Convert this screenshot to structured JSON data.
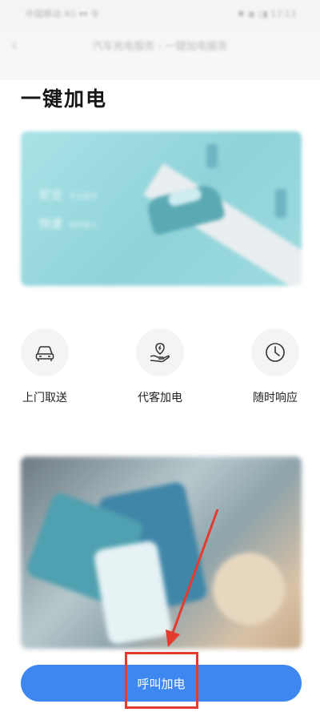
{
  "status_bar": {
    "left": "中国移动 4G ▾▾ 令",
    "right": "✱ ◉ ▯▮ 17:13"
  },
  "nav": {
    "title": "汽车充电服务 - 一键加电服务"
  },
  "page": {
    "title": "一键加电"
  },
  "banner": {
    "line1": "安全",
    "line1_sub": "专业服务",
    "line2": "快速",
    "line2_sub": "省时省心"
  },
  "features": [
    {
      "label": "上门取送",
      "icon": "car-icon"
    },
    {
      "label": "代客加电",
      "icon": "location-hand-icon"
    },
    {
      "label": "随时响应",
      "icon": "clock-icon"
    }
  ],
  "cta": {
    "label": "呼叫加电"
  },
  "colors": {
    "accent": "#3e86f0",
    "highlight": "#e53a2e",
    "banner": "#a9e2e6"
  }
}
